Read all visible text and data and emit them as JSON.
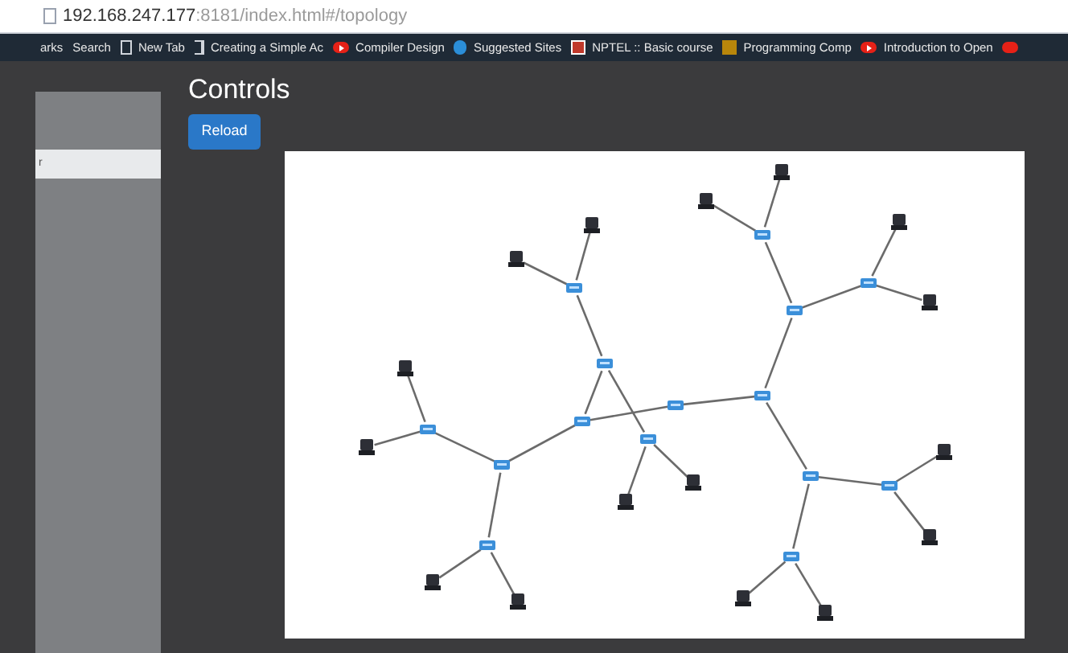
{
  "browser": {
    "url_host": "192.168.247.177",
    "url_rest": ":8181/index.html#/topology"
  },
  "bookmarks": [
    {
      "label": "arks",
      "kind": "plain"
    },
    {
      "label": "Search",
      "kind": "plain"
    },
    {
      "label": "New Tab",
      "kind": "page"
    },
    {
      "label": "Creating a Simple Ac",
      "kind": "bracket"
    },
    {
      "label": "Compiler Design",
      "kind": "video"
    },
    {
      "label": "Suggested Sites",
      "kind": "bing"
    },
    {
      "label": "NPTEL :: Basic course",
      "kind": "nptel"
    },
    {
      "label": "Programming Comp",
      "kind": "cc"
    },
    {
      "label": "Introduction to Open",
      "kind": "video"
    }
  ],
  "sidebar": {
    "items": [
      {
        "label": "r",
        "selected": true
      }
    ]
  },
  "controls": {
    "title": "Controls",
    "reload_button": "Reload"
  }
}
